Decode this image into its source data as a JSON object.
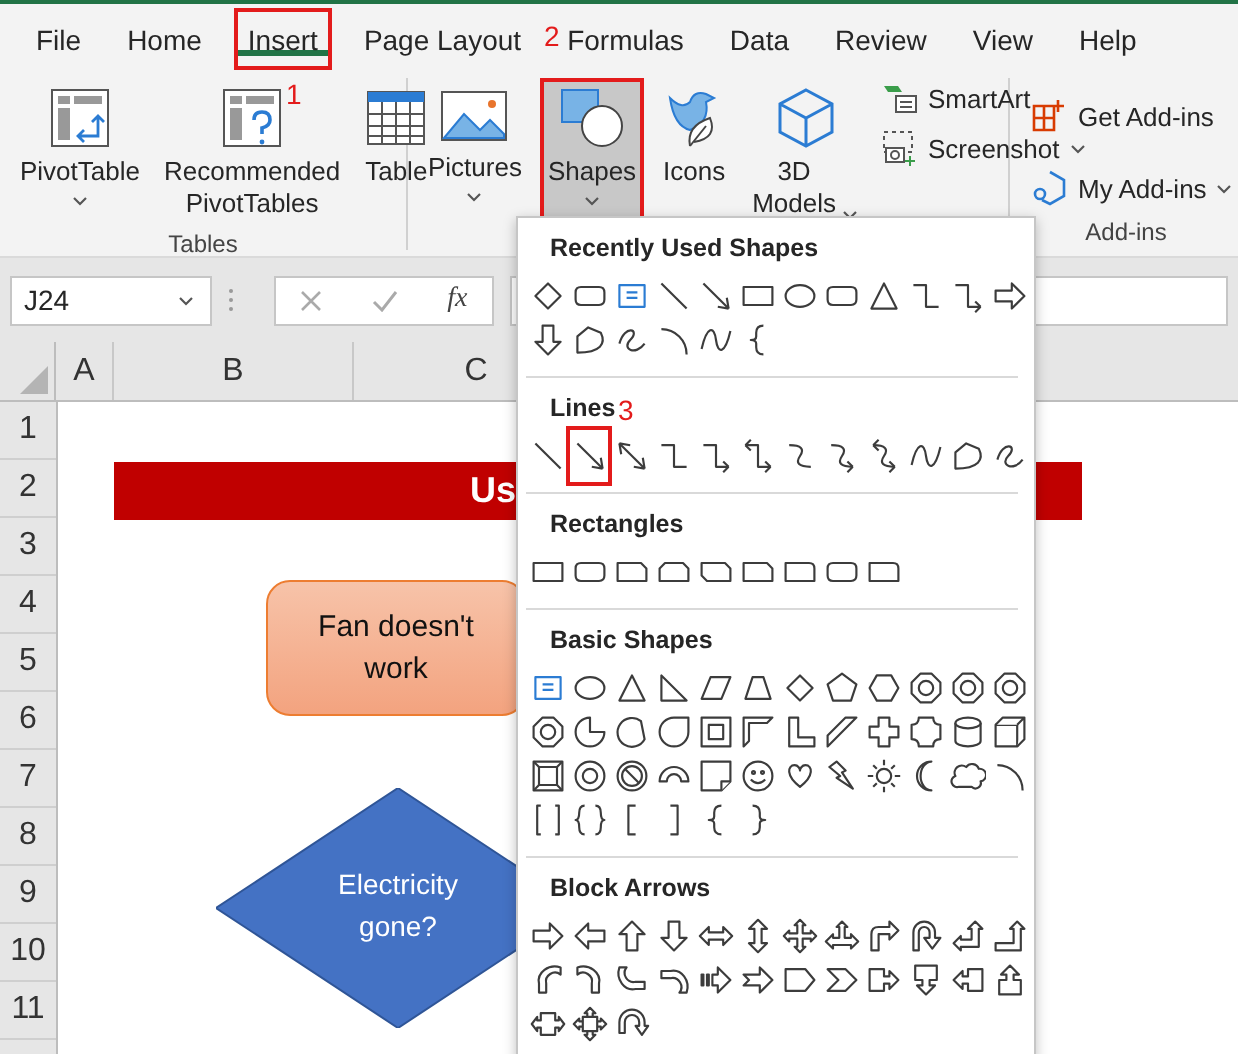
{
  "tabs": [
    {
      "label": "File",
      "selected": false,
      "outlined": false
    },
    {
      "label": "Home",
      "selected": false,
      "outlined": false
    },
    {
      "label": "Insert",
      "selected": true,
      "outlined": true
    },
    {
      "label": "Page Layout",
      "selected": false,
      "outlined": false
    },
    {
      "label": "Formulas",
      "selected": false,
      "outlined": false
    },
    {
      "label": "Data",
      "selected": false,
      "outlined": false
    },
    {
      "label": "Review",
      "selected": false,
      "outlined": false
    },
    {
      "label": "View",
      "selected": false,
      "outlined": false
    },
    {
      "label": "Help",
      "selected": false,
      "outlined": false
    }
  ],
  "ribbon_groups": [
    {
      "label": "Tables",
      "large_buttons": [
        {
          "kind": "pivot-table",
          "label": "PivotTable",
          "caret": true,
          "pressed": false,
          "outlined": false
        },
        {
          "kind": "recommended-pivot",
          "label": "Recommended PivotTables",
          "caret": false,
          "pressed": false,
          "outlined": false
        },
        {
          "kind": "table",
          "label": "Table",
          "caret": false,
          "pressed": false,
          "outlined": false
        }
      ]
    },
    {
      "large_buttons": [
        {
          "kind": "pictures",
          "label": "Pictures",
          "caret": true,
          "pressed": false,
          "outlined": false
        },
        {
          "kind": "shapes",
          "label": "Shapes",
          "caret": true,
          "pressed": true,
          "outlined": true
        },
        {
          "kind": "icons",
          "label": "Icons",
          "caret": false,
          "pressed": false,
          "outlined": false
        },
        {
          "kind": "models",
          "label": "3D Models",
          "caret": true,
          "pressed": false,
          "outlined": false
        }
      ],
      "small_buttons": [
        {
          "kind": "smartart",
          "label": "SmartArt",
          "caret": false
        },
        {
          "kind": "screenshot",
          "label": "Screenshot",
          "caret": true
        }
      ]
    },
    {
      "label": "Add-ins",
      "small_buttons": [
        {
          "kind": "get-add-ins",
          "label": "Get Add-ins",
          "caret": false
        },
        {
          "kind": "my-add-ins",
          "label": "My Add-ins",
          "caret": true
        }
      ]
    }
  ],
  "formula_bar": {
    "name_box": "J24",
    "function_label": "fx"
  },
  "columns": [
    "A",
    "B",
    "C"
  ],
  "rows": [
    "1",
    "2",
    "3",
    "4",
    "5",
    "6",
    "7",
    "8",
    "9",
    "10",
    "11"
  ],
  "banner": {
    "text": "Us"
  },
  "flowchart": [
    {
      "kind": "process",
      "text": "Fan doesn't work"
    },
    {
      "kind": "decision",
      "text": "Electricity gone?"
    }
  ],
  "shapes_menu": [
    {
      "title": "Recently Used Shapes",
      "outlined": false
    },
    {
      "title": "Lines",
      "outlined": true
    },
    {
      "title": "Rectangles",
      "outlined": false
    },
    {
      "title": "Basic Shapes",
      "outlined": false
    },
    {
      "title": "Block Arrows",
      "outlined": false
    }
  ],
  "annotations": [
    {
      "label": "1"
    },
    {
      "label": "2"
    },
    {
      "label": "3"
    }
  ]
}
